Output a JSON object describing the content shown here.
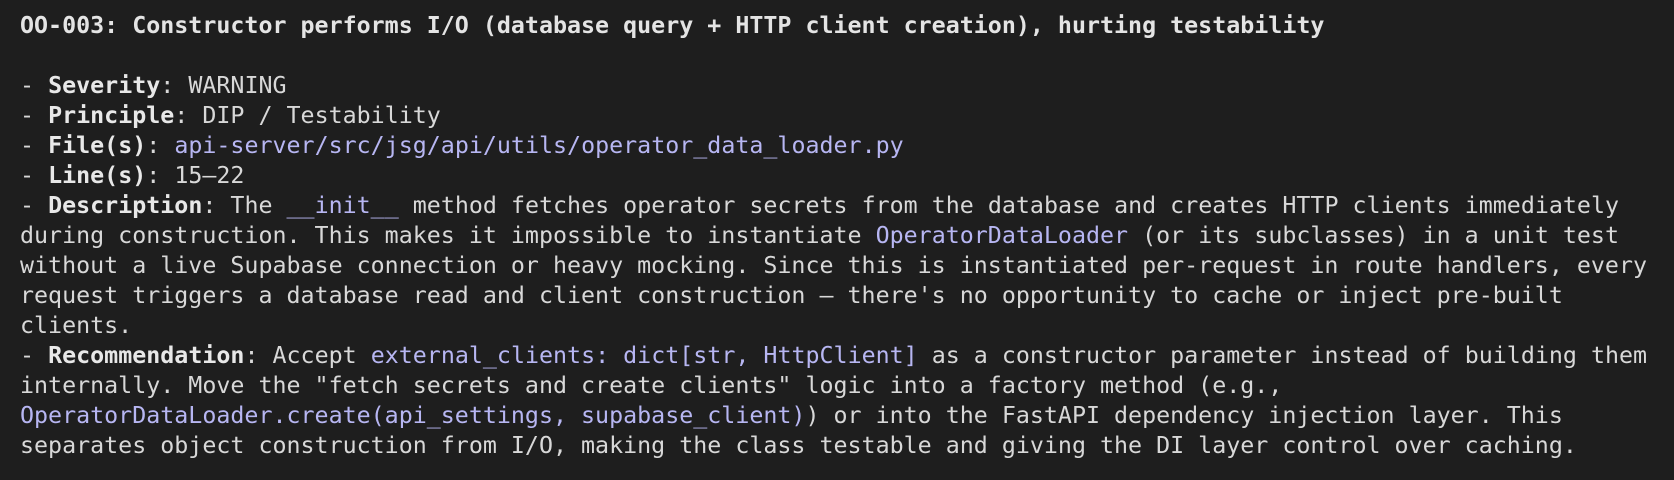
{
  "title": "OO-003: Constructor performs I/O (database query + HTTP client creation), hurting testability",
  "bullet": "- ",
  "colon": ": ",
  "severity": {
    "label": "Severity",
    "value": "WARNING"
  },
  "principle": {
    "label": "Principle",
    "value": "DIP / Testability"
  },
  "files": {
    "label": "File(s)",
    "value": "api-server/src/jsg/api/utils/operator_data_loader.py"
  },
  "lines": {
    "label": "Line(s)",
    "value": "15–22"
  },
  "description": {
    "label": "Description",
    "l1_a": "The ",
    "l1_code": "__init__",
    "l1_b": " method fetches operator secrets from the database and creates HTTP clients immediately",
    "l2_a": "during construction. This makes it impossible to instantiate ",
    "l2_code": "OperatorDataLoader",
    "l2_b": " (or its subclasses) in a unit test",
    "l3": "without a live Supabase connection or heavy mocking. Since this is instantiated per-request in route handlers, every",
    "l4": "request triggers a database read and client construction — there's no opportunity to cache or inject pre-built",
    "l5": "clients."
  },
  "recommendation": {
    "label": "Recommendation",
    "l1_a": "Accept ",
    "l1_code": "external_clients: dict[str, HttpClient]",
    "l1_b": " as a constructor parameter instead of building them",
    "l2": "internally. Move the \"fetch secrets and create clients\" logic into a factory method (e.g.,",
    "l3_code": "OperatorDataLoader.create(api_settings, supabase_client)",
    "l3_b": ") or into the FastAPI dependency injection layer. This",
    "l4": "separates object construction from I/O, making the class testable and giving the DI layer control over caching."
  },
  "colors": {
    "background": "#1e1e1e",
    "text": "#d8d8d8",
    "code": "#b7b6f2"
  }
}
